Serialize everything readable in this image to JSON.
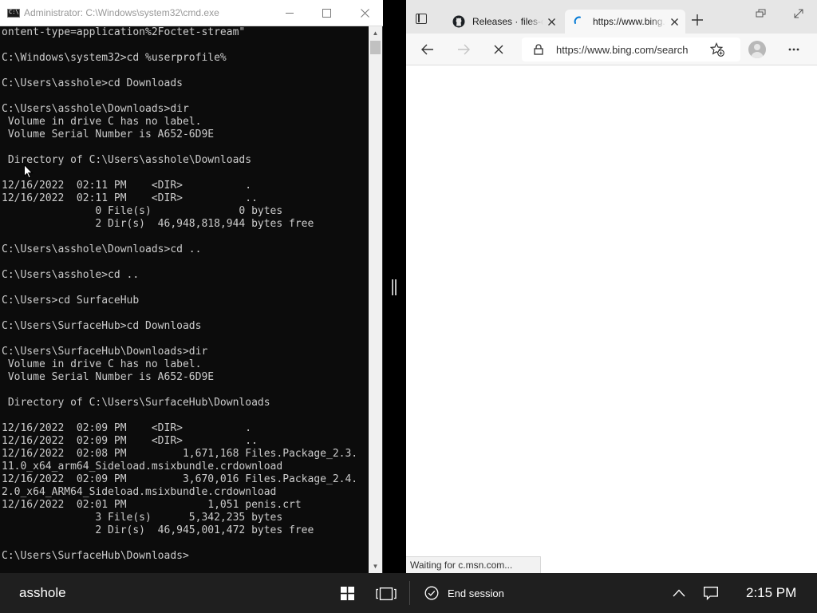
{
  "cmd": {
    "title": "Administrator: C:\\Windows\\system32\\cmd.exe",
    "lines": [
      "ontent-type=application%2Foctet-stream\"",
      "",
      "C:\\Windows\\system32>cd %userprofile%",
      "",
      "C:\\Users\\asshole>cd Downloads",
      "",
      "C:\\Users\\asshole\\Downloads>dir",
      " Volume in drive C has no label.",
      " Volume Serial Number is A652-6D9E",
      "",
      " Directory of C:\\Users\\asshole\\Downloads",
      "",
      "12/16/2022  02:11 PM    <DIR>          .",
      "12/16/2022  02:11 PM    <DIR>          ..",
      "               0 File(s)              0 bytes",
      "               2 Dir(s)  46,948,818,944 bytes free",
      "",
      "C:\\Users\\asshole\\Downloads>cd ..",
      "",
      "C:\\Users\\asshole>cd ..",
      "",
      "C:\\Users>cd SurfaceHub",
      "",
      "C:\\Users\\SurfaceHub>cd Downloads",
      "",
      "C:\\Users\\SurfaceHub\\Downloads>dir",
      " Volume in drive C has no label.",
      " Volume Serial Number is A652-6D9E",
      "",
      " Directory of C:\\Users\\SurfaceHub\\Downloads",
      "",
      "12/16/2022  02:09 PM    <DIR>          .",
      "12/16/2022  02:09 PM    <DIR>          ..",
      "12/16/2022  02:08 PM         1,671,168 Files.Package_2.3.",
      "11.0_x64_arm64_Sideload.msixbundle.crdownload",
      "12/16/2022  02:09 PM         3,670,016 Files.Package_2.4.",
      "2.0_x64_ARM64_Sideload.msixbundle.crdownload",
      "12/16/2022  02:01 PM             1,051 penis.crt",
      "               3 File(s)      5,342,235 bytes",
      "               2 Dir(s)  46,945,001,472 bytes free",
      "",
      "C:\\Users\\SurfaceHub\\Downloads>"
    ]
  },
  "browser": {
    "tabs": [
      {
        "title": "Releases · files-community",
        "favicon": "github-icon",
        "active": false
      },
      {
        "title": "https://www.bing.com",
        "favicon": "loading-spinner-icon",
        "active": true
      }
    ],
    "url": "https://www.bing.com/search",
    "status": "Waiting for c.msn.com...",
    "accent": "#0078d4"
  },
  "taskbar": {
    "user": "asshole",
    "end_session": "End session",
    "time": "2:15 PM",
    "icons": [
      "windows-icon",
      "task-view-icon",
      "end-session-icon",
      "chevron-up-icon",
      "action-center-icon"
    ]
  }
}
